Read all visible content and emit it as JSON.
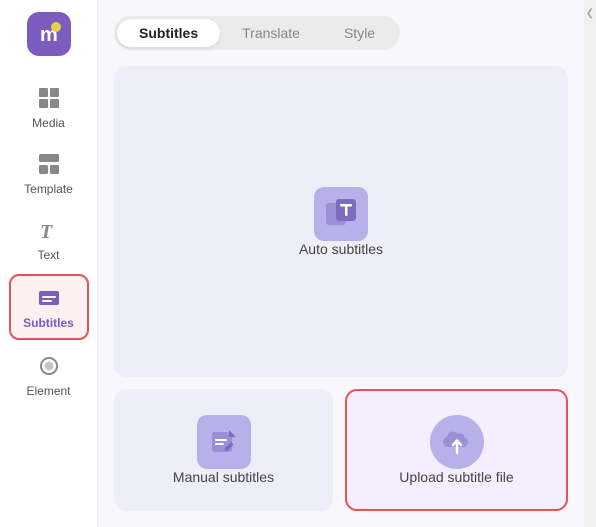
{
  "app": {
    "logo_label": "m"
  },
  "sidebar": {
    "items": [
      {
        "id": "media",
        "label": "Media",
        "active": false
      },
      {
        "id": "template",
        "label": "Template",
        "active": false
      },
      {
        "id": "text",
        "label": "Text",
        "active": false
      },
      {
        "id": "subtitles",
        "label": "Subtitles",
        "active": true
      },
      {
        "id": "element",
        "label": "Element",
        "active": false
      }
    ]
  },
  "tabs": [
    {
      "id": "subtitles",
      "label": "Subtitles",
      "active": true
    },
    {
      "id": "translate",
      "label": "Translate",
      "active": false
    },
    {
      "id": "style",
      "label": "Style",
      "active": false
    }
  ],
  "cards": {
    "auto_subtitles": {
      "label": "Auto subtitles"
    },
    "manual_subtitles": {
      "label": "Manual subtitles"
    },
    "upload_subtitle_file": {
      "label": "Upload subtitle file"
    }
  }
}
